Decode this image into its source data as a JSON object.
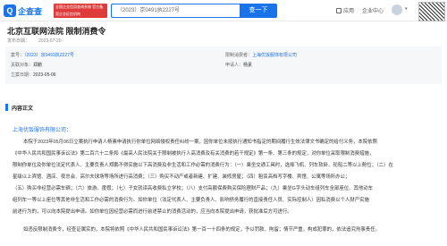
{
  "header": {
    "logo_text": "企查查",
    "badge_text": "全国企业信用查询系统 官方备案企业征信机构",
    "search_value": "（2023）京0491执2227号",
    "search_button": "查一下",
    "app_label": "应用",
    "center_label": "企业中心",
    "avatar_chevron": "▾"
  },
  "page": {
    "title": "北京互联网法院 限制消费令",
    "publish_label": "发布日期：",
    "publish_value": "2023-07-20"
  },
  "meta": {
    "case_no_label": "案号：",
    "case_no_value": "（2023）京0491执2227号",
    "limited_label": "限制消费者：",
    "limited_value": "上海优饭服饰有限公司",
    "related_label": "关联对象：",
    "related_value": "郑鹏",
    "applicant_label": "申请人：",
    "applicant_value": "杨素",
    "filing_label": "立案日期：",
    "filing_value": "2023-05-06"
  },
  "content": {
    "section_title": "内容正文",
    "addressee": "上海优饭服饰有限公司：",
    "paragraphs": [
      "本院于2023年05月06日立案执行申请人杨素申请执行你单位网络侵权责任纠纷一案，因你单位未按执行通知书指定的期间履行生效法律文书确定的给付义务，本院依照",
      "《中华人民共和国民事诉讼法》第二百六十二条和《最高人民法院关于限制被执行人高消费及有关消费的若干规定》第一条、第三条的规定，对你单位采取限制消费措施，",
      "限制你单位及你单位法定代表人、主要负责人郑鹏不得实施以下高消费及非生活和工作必需的消费行为：（一）乘坐交通工具时，选择飞机、列车软卧、轮船二等以上舱位；（二）在",
      "星级以上宾馆、酒店、夜总会、高尔夫球场等场所进行高消费；（三）购买不动产或者新建、扩建、装修房屋；（四）租赁高档写字楼、宾馆、公寓等场所办公；",
      "（五）购买非经营必需车辆；（六）旅游、度假；（七）子女就读高收费私立学校；（八）支付高额保费购买保险理财产品；（九）乘坐G字头动车组列车全部座位、其他动车",
      "组列车一等以上座位等其他非生活和工作必需的消费行为。如你单位（法定代表人、主要负责人、影响债务履行的直接责任人员、实际控制人）因私消费以个人财产实施",
      "前述行为的，可以向本院提出申请。如你单位因经营必需而进行前述禁止的消费活动的，应当向本院提出申请，获批准后方可进行。",
      "如违反限制消费令，经查证属实的，本院将依照《中华人民共和国民事诉讼法》第一百一十四条的规定，予以罚款、拘留；情节严重，构成犯罪的，依法追究刑事责任。"
    ]
  }
}
